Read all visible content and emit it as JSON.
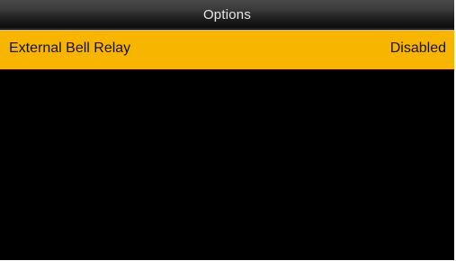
{
  "header": {
    "title": "Options"
  },
  "menu": {
    "items": [
      {
        "label": "External Bell Relay",
        "value": "Disabled",
        "selected": true
      }
    ]
  },
  "colors": {
    "selection_highlight": "#f7b500",
    "background": "#000000",
    "title_text": "#e8e8e8"
  }
}
